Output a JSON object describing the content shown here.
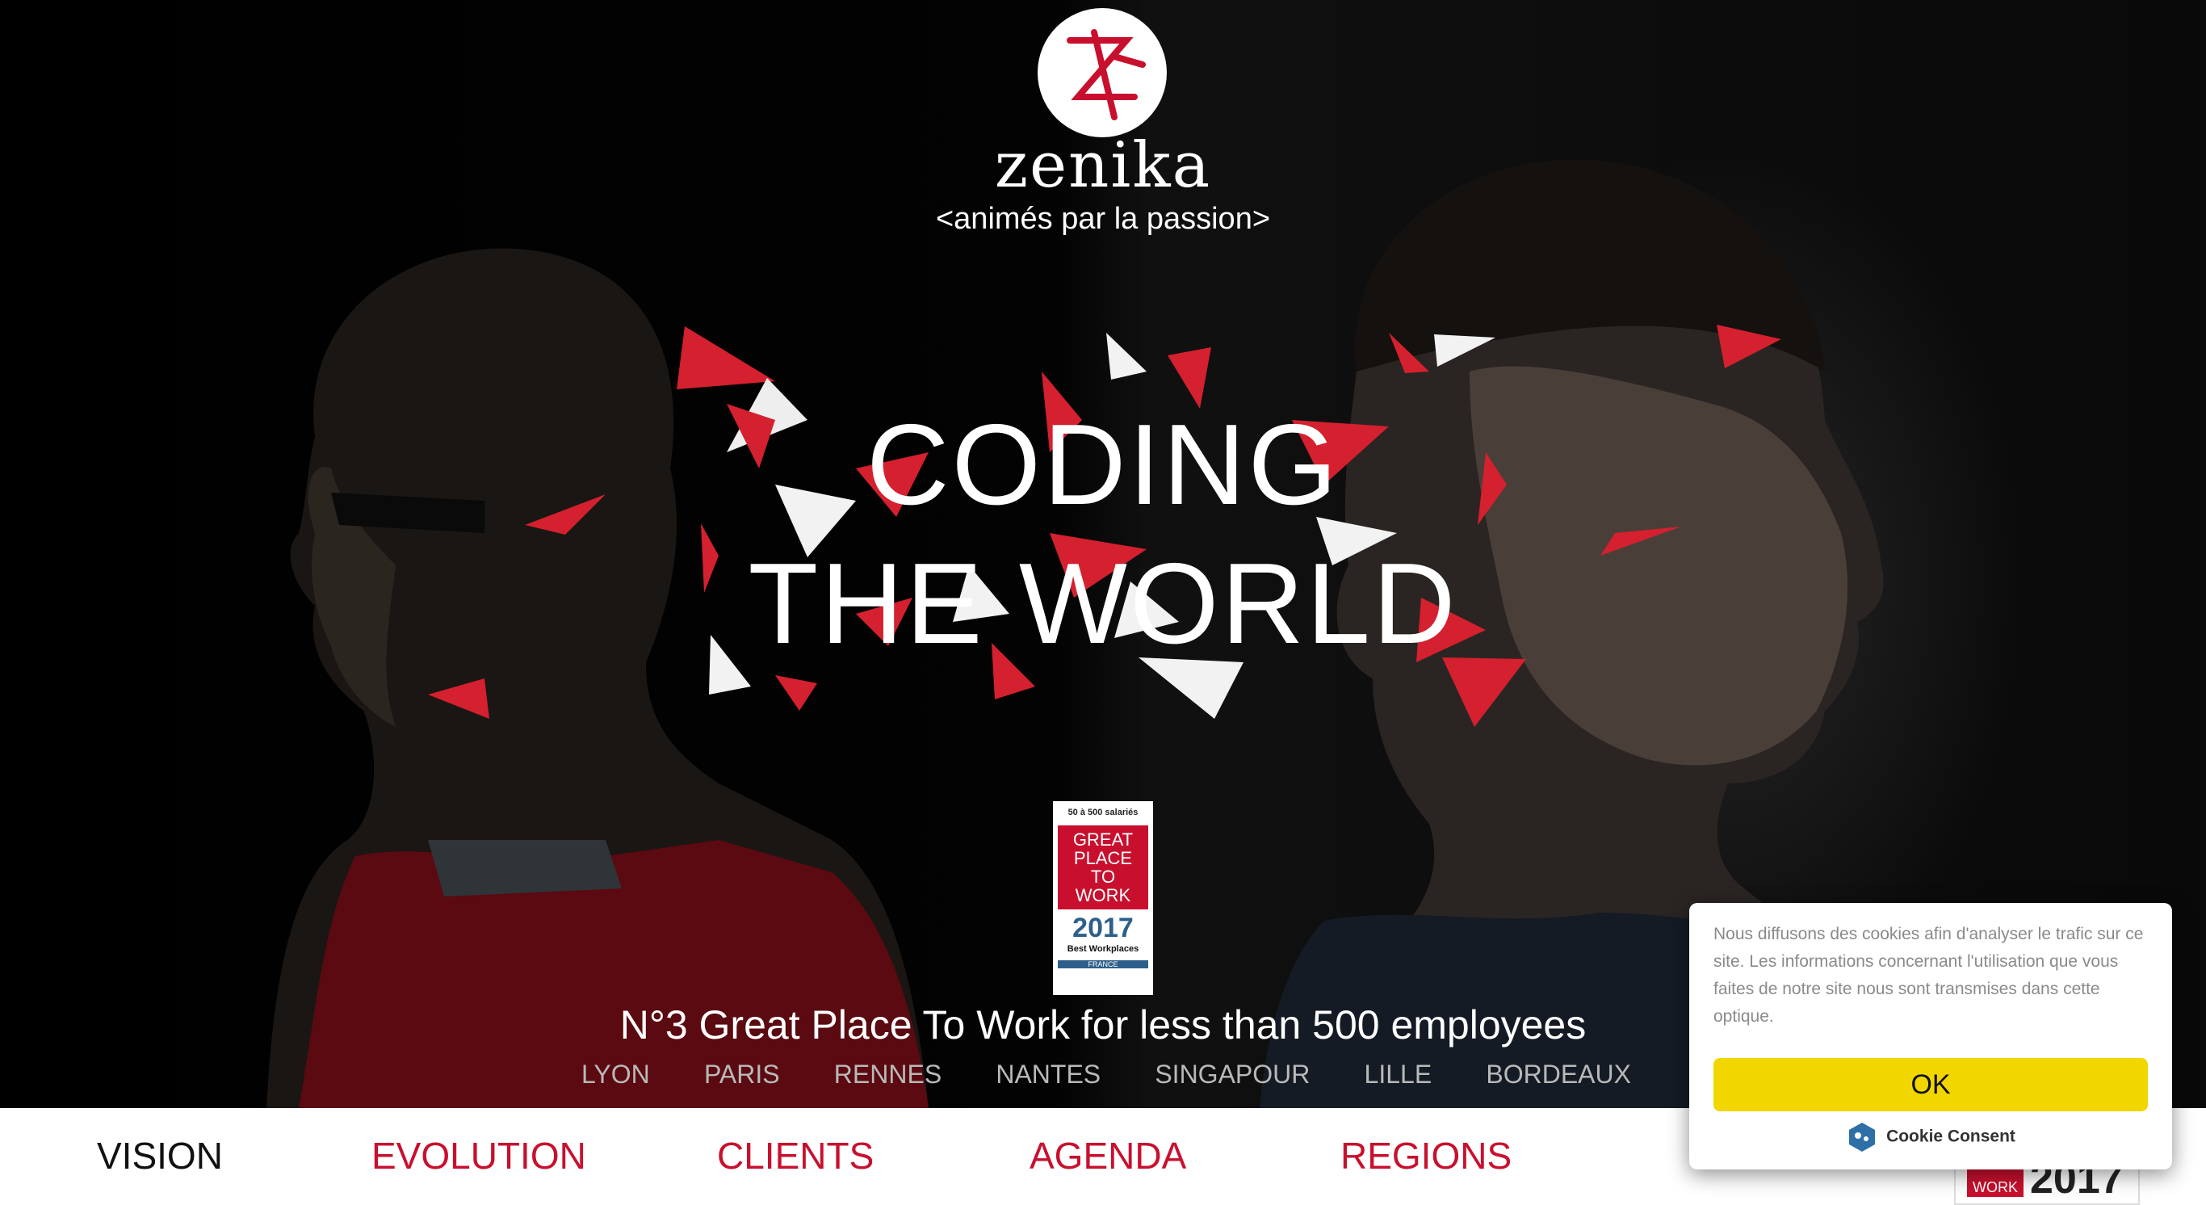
{
  "brand": {
    "name": "zenika",
    "tagline": "<animés par la passion>"
  },
  "hero": {
    "headline_line1": "CODING",
    "headline_line2": "THE WORLD"
  },
  "badge": {
    "top": "50 à 500 salariés",
    "title_lines": [
      "GREAT",
      "PLACE",
      "TO",
      "WORK"
    ],
    "year": "2017",
    "subtitle": "Best Workplaces",
    "country": "FRANCE"
  },
  "award_text": "N°3 Great Place To Work for less than 500 employees",
  "cities": [
    "LYON",
    "PARIS",
    "RENNES",
    "NANTES",
    "SINGAPOUR",
    "LILLE",
    "BORDEAUX"
  ],
  "nav": [
    "VISION",
    "EVOLUTION",
    "CLIENTS",
    "AGENDA",
    "REGIONS"
  ],
  "corner_badge": {
    "text": "WORK",
    "year": "2017"
  },
  "cookie": {
    "message": "Nous diffusons des cookies afin d'analyser le trafic sur ce site. Les informations concernant l'utilisation que vous faites de notre site nous sont transmises dans cette optique.",
    "ok_label": "OK",
    "brand": "Cookie Consent"
  },
  "colors": {
    "accent_red": "#c8102e",
    "cookie_button": "#f1d600"
  }
}
